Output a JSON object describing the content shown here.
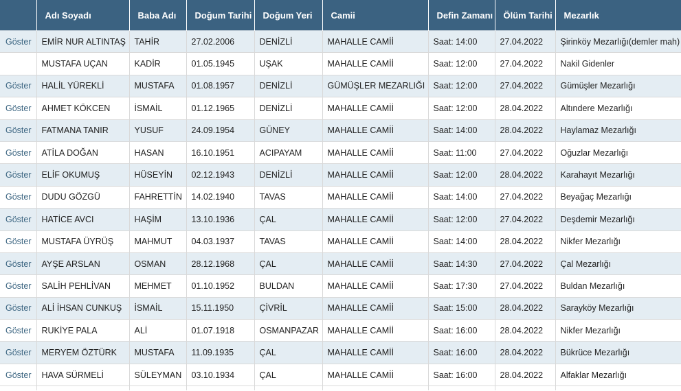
{
  "headers": [
    "",
    "Adı Soyadı",
    "Baba Adı",
    "Doğum Tarihi",
    "Doğum Yeri",
    "Camii",
    "Defin Zamanı",
    "Ölüm Tarihi",
    "Mezarlık"
  ],
  "rows": [
    {
      "show": "Göster",
      "name": "EMİR NUR ALTINTAŞ",
      "father": "TAHİR",
      "birth_date": "27.02.2006",
      "birth_place": "DENİZLİ",
      "mosque": "MAHALLE CAMİİ",
      "burial_time": "Saat: 14:00",
      "death_date": "27.04.2022",
      "cemetery": "Şirinköy Mezarlığı(demler mah)"
    },
    {
      "show": "",
      "name": "MUSTAFA UÇAN",
      "father": "KADİR",
      "birth_date": "01.05.1945",
      "birth_place": "UŞAK",
      "mosque": "MAHALLE CAMİİ",
      "burial_time": "Saat: 12:00",
      "death_date": "27.04.2022",
      "cemetery": "Nakil Gidenler"
    },
    {
      "show": "Göster",
      "name": "HALİL YÜREKLİ",
      "father": "MUSTAFA",
      "birth_date": "01.08.1957",
      "birth_place": "DENİZLİ",
      "mosque": "GÜMÜŞLER MEZARLIĞI",
      "burial_time": "Saat: 12:00",
      "death_date": "27.04.2022",
      "cemetery": "Gümüşler Mezarlığı"
    },
    {
      "show": "Göster",
      "name": "AHMET KÖKCEN",
      "father": "İSMAİL",
      "birth_date": "01.12.1965",
      "birth_place": "DENİZLİ",
      "mosque": "MAHALLE CAMİİ",
      "burial_time": "Saat: 12:00",
      "death_date": "28.04.2022",
      "cemetery": "Altındere Mezarlığı"
    },
    {
      "show": "Göster",
      "name": "FATMANA TANIR",
      "father": "YUSUF",
      "birth_date": "24.09.1954",
      "birth_place": "GÜNEY",
      "mosque": "MAHALLE CAMİİ",
      "burial_time": "Saat: 14:00",
      "death_date": "28.04.2022",
      "cemetery": "Haylamaz Mezarlığı"
    },
    {
      "show": "Göster",
      "name": "ATİLA DOĞAN",
      "father": "HASAN",
      "birth_date": "16.10.1951",
      "birth_place": "ACIPAYAM",
      "mosque": "MAHALLE CAMİİ",
      "burial_time": "Saat: 11:00",
      "death_date": "27.04.2022",
      "cemetery": "Oğuzlar Mezarlığı"
    },
    {
      "show": "Göster",
      "name": "ELİF OKUMUŞ",
      "father": "HÜSEYİN",
      "birth_date": "02.12.1943",
      "birth_place": "DENİZLİ",
      "mosque": "MAHALLE CAMİİ",
      "burial_time": "Saat: 12:00",
      "death_date": "28.04.2022",
      "cemetery": "Karahayıt Mezarlığı"
    },
    {
      "show": "Göster",
      "name": "DUDU GÖZGÜ",
      "father": "FAHRETTİN",
      "birth_date": "14.02.1940",
      "birth_place": "TAVAS",
      "mosque": "MAHALLE CAMİİ",
      "burial_time": "Saat: 14:00",
      "death_date": "27.04.2022",
      "cemetery": "Beyağaç Mezarlığı"
    },
    {
      "show": "Göster",
      "name": "HATİCE AVCI",
      "father": "HAŞİM",
      "birth_date": "13.10.1936",
      "birth_place": "ÇAL",
      "mosque": "MAHALLE CAMİİ",
      "burial_time": "Saat: 12:00",
      "death_date": "27.04.2022",
      "cemetery": "Deşdemir Mezarlığı"
    },
    {
      "show": "Göster",
      "name": "MUSTAFA ÜYRÜŞ",
      "father": "MAHMUT",
      "birth_date": "04.03.1937",
      "birth_place": "TAVAS",
      "mosque": "MAHALLE CAMİİ",
      "burial_time": "Saat: 14:00",
      "death_date": "28.04.2022",
      "cemetery": "Nikfer Mezarlığı"
    },
    {
      "show": "Göster",
      "name": "AYŞE ARSLAN",
      "father": "OSMAN",
      "birth_date": "28.12.1968",
      "birth_place": "ÇAL",
      "mosque": "MAHALLE CAMİİ",
      "burial_time": "Saat: 14:30",
      "death_date": "27.04.2022",
      "cemetery": "Çal Mezarlığı"
    },
    {
      "show": "Göster",
      "name": "SALİH PEHLİVAN",
      "father": "MEHMET",
      "birth_date": "01.10.1952",
      "birth_place": "BULDAN",
      "mosque": "MAHALLE CAMİİ",
      "burial_time": "Saat: 17:30",
      "death_date": "27.04.2022",
      "cemetery": "Buldan Mezarlığı"
    },
    {
      "show": "Göster",
      "name": "ALİ İHSAN CUNKUŞ",
      "father": "İSMAİL",
      "birth_date": "15.11.1950",
      "birth_place": "ÇİVRİL",
      "mosque": "MAHALLE CAMİİ",
      "burial_time": "Saat: 15:00",
      "death_date": "28.04.2022",
      "cemetery": "Sarayköy Mezarlığı"
    },
    {
      "show": "Göster",
      "name": "RUKİYE PALA",
      "father": "ALİ",
      "birth_date": "01.07.1918",
      "birth_place": "OSMANPAZAR",
      "mosque": "MAHALLE CAMİİ",
      "burial_time": "Saat: 16:00",
      "death_date": "28.04.2022",
      "cemetery": "Nikfer Mezarlığı"
    },
    {
      "show": "Göster",
      "name": "MERYEM ÖZTÜRK",
      "father": "MUSTAFA",
      "birth_date": "11.09.1935",
      "birth_place": "ÇAL",
      "mosque": "MAHALLE CAMİİ",
      "burial_time": "Saat: 16:00",
      "death_date": "28.04.2022",
      "cemetery": "Bükrüce Mezarlığı"
    },
    {
      "show": "Göster",
      "name": "HAVA SÜRMELİ",
      "father": "SÜLEYMAN",
      "birth_date": "03.10.1934",
      "birth_place": "ÇAL",
      "mosque": "MAHALLE CAMİİ",
      "burial_time": "Saat: 16:00",
      "death_date": "28.04.2022",
      "cemetery": "Alfaklar Mezarlığı"
    }
  ]
}
